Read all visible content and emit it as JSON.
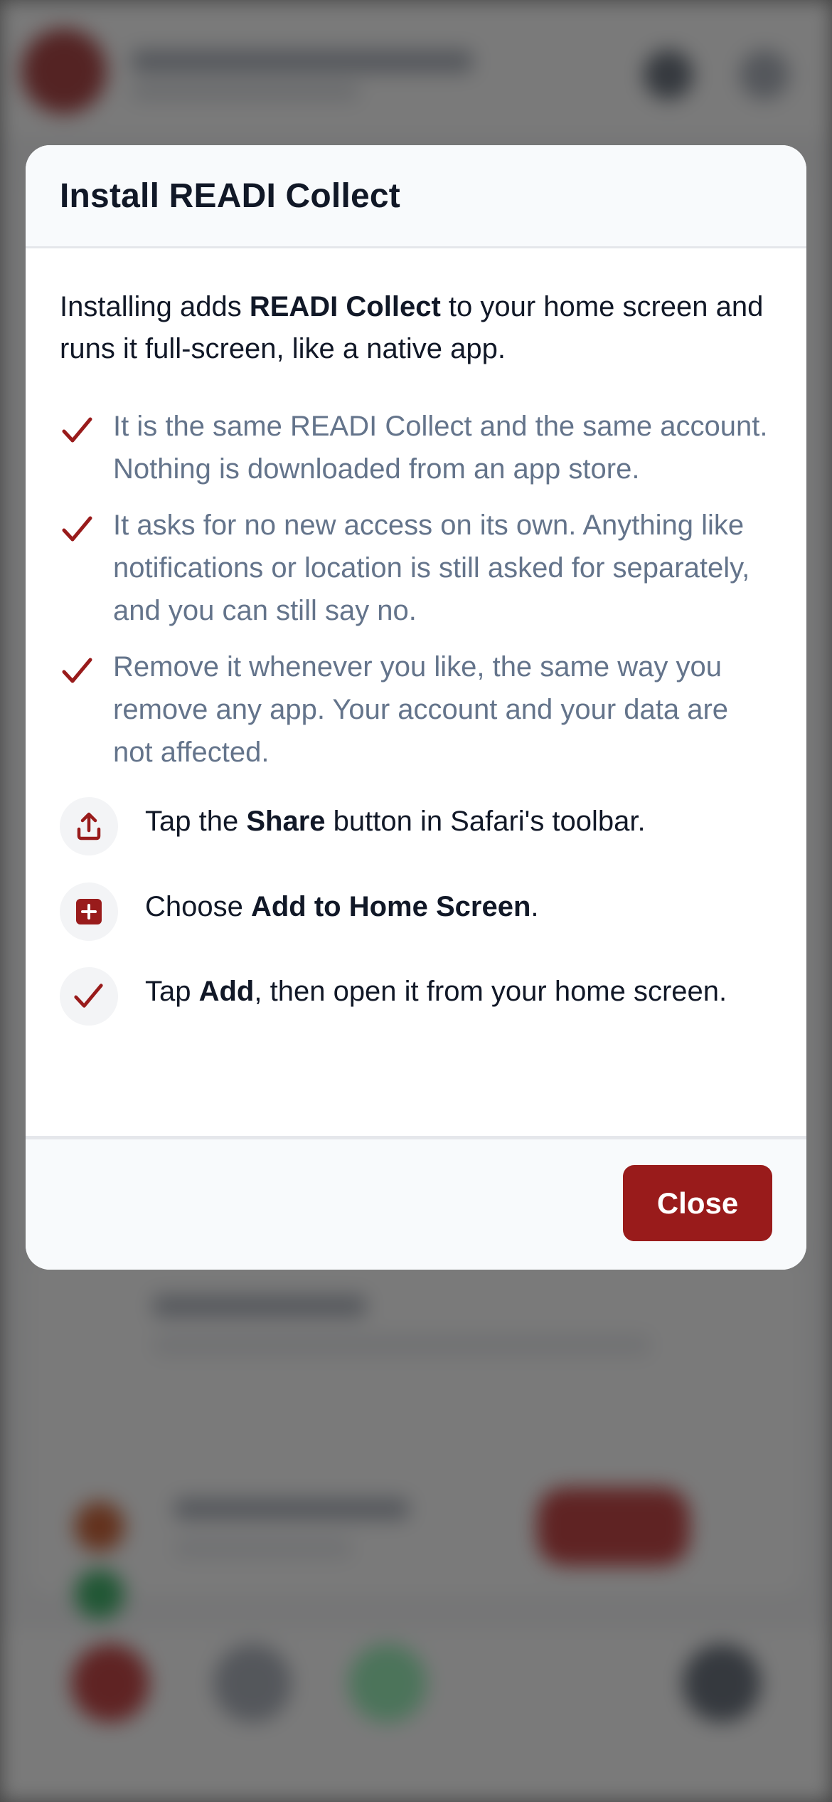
{
  "modal": {
    "title": "Install READI Collect",
    "intro": {
      "before": "Installing adds ",
      "app_name": "READI Collect",
      "after": " to your home screen and runs it full-screen, like a native app."
    },
    "reasons": [
      "It is the same READI Collect and the same account. Nothing is downloaded from an app store.",
      "It asks for no new access on its own. Anything like notifications or location is still asked for separately, and you can still say no.",
      "Remove it whenever you like, the same way you remove any app. Your account and your data are not affected."
    ],
    "steps": [
      {
        "icon": "share-icon",
        "before": "Tap the ",
        "bold": "Share",
        "after": " button in Safari's toolbar."
      },
      {
        "icon": "add-square-icon",
        "before": "Choose ",
        "bold": "Add to Home Screen",
        "after": "."
      },
      {
        "icon": "check-icon",
        "before": "Tap ",
        "bold": "Add",
        "after": ", then open it from your home screen."
      }
    ],
    "close_label": "Close"
  },
  "colors": {
    "accent": "#991b1b",
    "text_primary": "#111827",
    "text_muted": "#64748b"
  }
}
